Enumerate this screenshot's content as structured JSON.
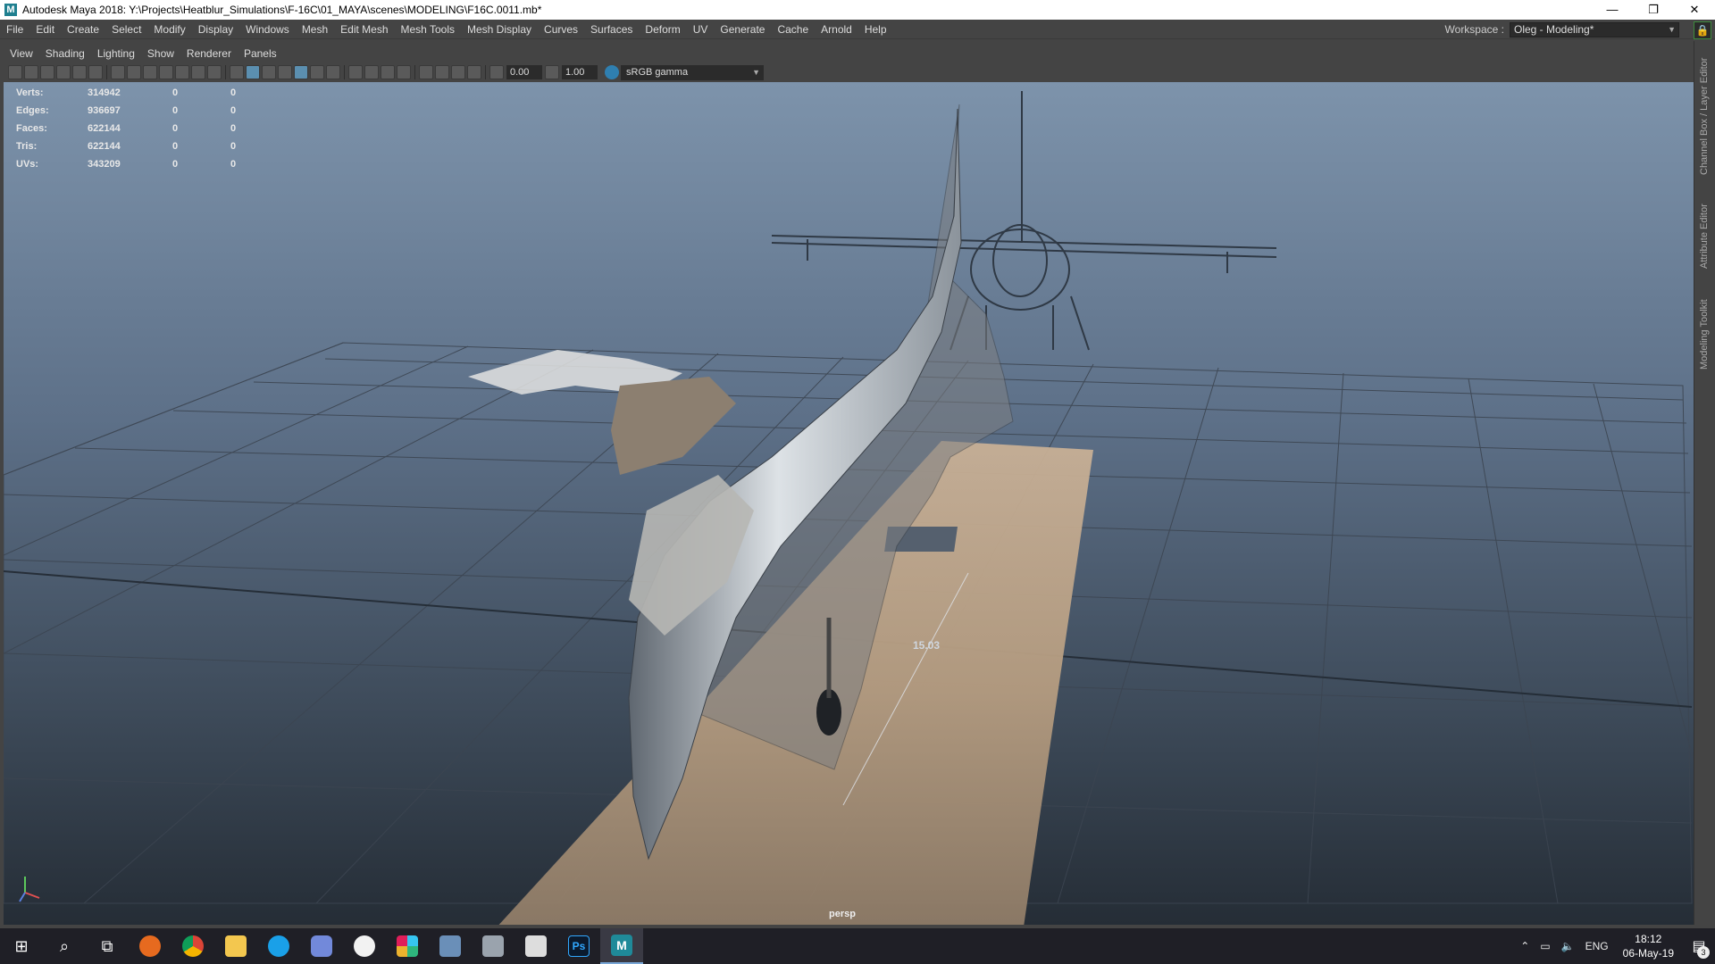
{
  "window": {
    "title": "Autodesk Maya 2018: Y:\\Projects\\Heatblur_Simulations\\F-16C\\01_MAYA\\scenes\\MODELING\\F16C.0011.mb*",
    "app_icon": "M",
    "controls": {
      "minimize": "—",
      "restore": "❐",
      "close": "✕"
    }
  },
  "menubar": {
    "items": [
      "File",
      "Edit",
      "Create",
      "Select",
      "Modify",
      "Display",
      "Windows",
      "Mesh",
      "Edit Mesh",
      "Mesh Tools",
      "Mesh Display",
      "Curves",
      "Surfaces",
      "Deform",
      "UV",
      "Generate",
      "Cache",
      "Arnold",
      "Help"
    ],
    "workspace_label": "Workspace :",
    "workspace_value": "Oleg - Modeling*"
  },
  "side_tabs": [
    "Channel Box / Layer Editor",
    "Attribute Editor",
    "Modeling Toolkit"
  ],
  "panel": {
    "menu": [
      "View",
      "Shading",
      "Lighting",
      "Show",
      "Renderer",
      "Panels"
    ],
    "exposure": "0.00",
    "gamma": "1.00",
    "color_space": "sRGB gamma"
  },
  "hud": {
    "rows": [
      {
        "label": "Verts:",
        "value": "314942",
        "sel": "0",
        "comp": "0"
      },
      {
        "label": "Edges:",
        "value": "936697",
        "sel": "0",
        "comp": "0"
      },
      {
        "label": "Faces:",
        "value": "622144",
        "sel": "0",
        "comp": "0"
      },
      {
        "label": "Tris:",
        "value": "622144",
        "sel": "0",
        "comp": "0"
      },
      {
        "label": "UVs:",
        "value": "343209",
        "sel": "0",
        "comp": "0"
      }
    ],
    "camera": "persp",
    "measure": "15.03"
  },
  "taskbar": {
    "apps": [
      "windows-start",
      "search",
      "task-view",
      "firefox",
      "chrome",
      "file-explorer",
      "skype",
      "discord",
      "itunes",
      "slack",
      "outlook",
      "printer",
      "calculator",
      "photoshop",
      "maya"
    ],
    "photoshop_label": "Ps",
    "maya_label": "M",
    "tray_lang": "ENG",
    "time": "18:12",
    "date": "06-May-19",
    "notifications": "3"
  }
}
